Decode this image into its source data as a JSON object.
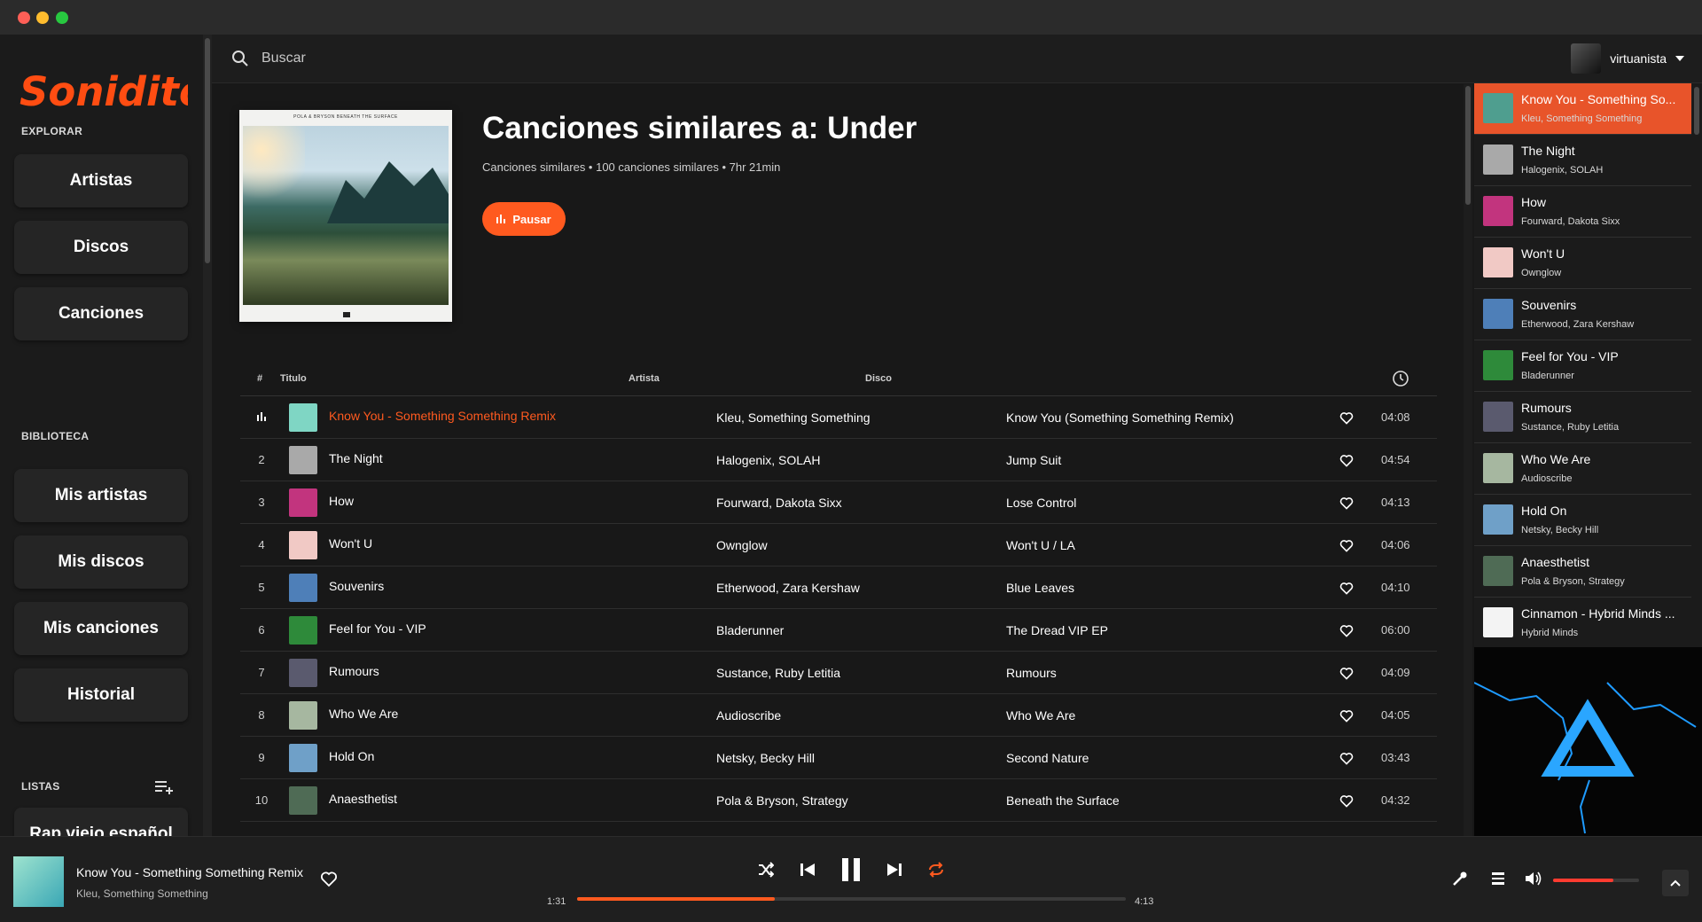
{
  "app": {
    "brand": "Soniditos",
    "brand_color": "#ff4d12",
    "accent": "#ff5a1f"
  },
  "sidebar": {
    "explore_label": "EXPLORAR",
    "explore_items": [
      "Artistas",
      "Discos",
      "Canciones"
    ],
    "library_label": "BIBLIOTECA",
    "library_items": [
      "Mis artistas",
      "Mis discos",
      "Mis canciones",
      "Historial"
    ],
    "lists_label": "LISTAS",
    "lists": [
      "Rap viejo español"
    ]
  },
  "search": {
    "placeholder": "Buscar"
  },
  "user": {
    "name": "virtuanista"
  },
  "playlist": {
    "cover_title": "POLA & BRYSON  BENEATH THE SURFACE",
    "title": "Canciones similares a: Under",
    "subtitle": "Canciones similares • 100 canciones similares • 7hr 21min",
    "play_button": "Pausar"
  },
  "table": {
    "columns": {
      "num": "#",
      "title": "Titulo",
      "artist": "Artista",
      "album": "Disco"
    },
    "rows": [
      {
        "num": "",
        "title": "Know You - Something Something Remix",
        "artist": "Kleu, Something Something",
        "album": "Know You (Something Something Remix)",
        "duration": "04:08",
        "thumb": "#7fd6c4",
        "active": true
      },
      {
        "num": "2",
        "title": "The Night",
        "artist": "Halogenix, SOLAH",
        "album": "Jump Suit",
        "duration": "04:54",
        "thumb": "#a9a9a9"
      },
      {
        "num": "3",
        "title": "How",
        "artist": "Fourward, Dakota Sixx",
        "album": "Lose Control",
        "duration": "04:13",
        "thumb": "#c2347e"
      },
      {
        "num": "4",
        "title": "Won't U",
        "artist": "Ownglow",
        "album": "Won't U / LA",
        "duration": "04:06",
        "thumb": "#f1c9c5"
      },
      {
        "num": "5",
        "title": "Souvenirs",
        "artist": "Etherwood, Zara Kershaw",
        "album": "Blue Leaves",
        "duration": "04:10",
        "thumb": "#4e7fb8"
      },
      {
        "num": "6",
        "title": "Feel for You - VIP",
        "artist": "Bladerunner",
        "album": "The Dread VIP EP",
        "duration": "06:00",
        "thumb": "#2e8a3a"
      },
      {
        "num": "7",
        "title": "Rumours",
        "artist": "Sustance, Ruby Letitia",
        "album": "Rumours",
        "duration": "04:09",
        "thumb": "#5a5a6e"
      },
      {
        "num": "8",
        "title": "Who We Are",
        "artist": "Audioscribe",
        "album": "Who We Are",
        "duration": "04:05",
        "thumb": "#a6b7a0"
      },
      {
        "num": "9",
        "title": "Hold On",
        "artist": "Netsky, Becky Hill",
        "album": "Second Nature",
        "duration": "03:43",
        "thumb": "#6fa0c8"
      },
      {
        "num": "10",
        "title": "Anaesthetist",
        "artist": "Pola & Bryson, Strategy",
        "album": "Beneath the Surface",
        "duration": "04:32",
        "thumb": "#4f6b55"
      }
    ]
  },
  "queue": [
    {
      "title": "Know You - Something So...",
      "artist": "Kleu, Something Something",
      "thumb": "#4f9e8f",
      "active": true
    },
    {
      "title": "The Night",
      "artist": "Halogenix, SOLAH",
      "thumb": "#a9a9a9"
    },
    {
      "title": "How",
      "artist": "Fourward, Dakota Sixx",
      "thumb": "#c2347e"
    },
    {
      "title": "Won't U",
      "artist": "Ownglow",
      "thumb": "#f1c9c5"
    },
    {
      "title": "Souvenirs",
      "artist": "Etherwood, Zara Kershaw",
      "thumb": "#4e7fb8"
    },
    {
      "title": "Feel for You - VIP",
      "artist": "Bladerunner",
      "thumb": "#2e8a3a"
    },
    {
      "title": "Rumours",
      "artist": "Sustance, Ruby Letitia",
      "thumb": "#5a5a6e"
    },
    {
      "title": "Who We Are",
      "artist": "Audioscribe",
      "thumb": "#a6b7a0"
    },
    {
      "title": "Hold On",
      "artist": "Netsky, Becky Hill",
      "thumb": "#6fa0c8"
    },
    {
      "title": "Anaesthetist",
      "artist": "Pola & Bryson, Strategy",
      "thumb": "#4f6b55"
    },
    {
      "title": "Cinnamon - Hybrid Minds ...",
      "artist": "Hybrid Minds",
      "thumb": "#f3f3f3"
    }
  ],
  "player": {
    "title": "Know You - Something Something Remix",
    "artist": "Kleu, Something Something",
    "elapsed": "1:31",
    "total": "4:13",
    "progress": 0.36,
    "volume": 0.7
  }
}
